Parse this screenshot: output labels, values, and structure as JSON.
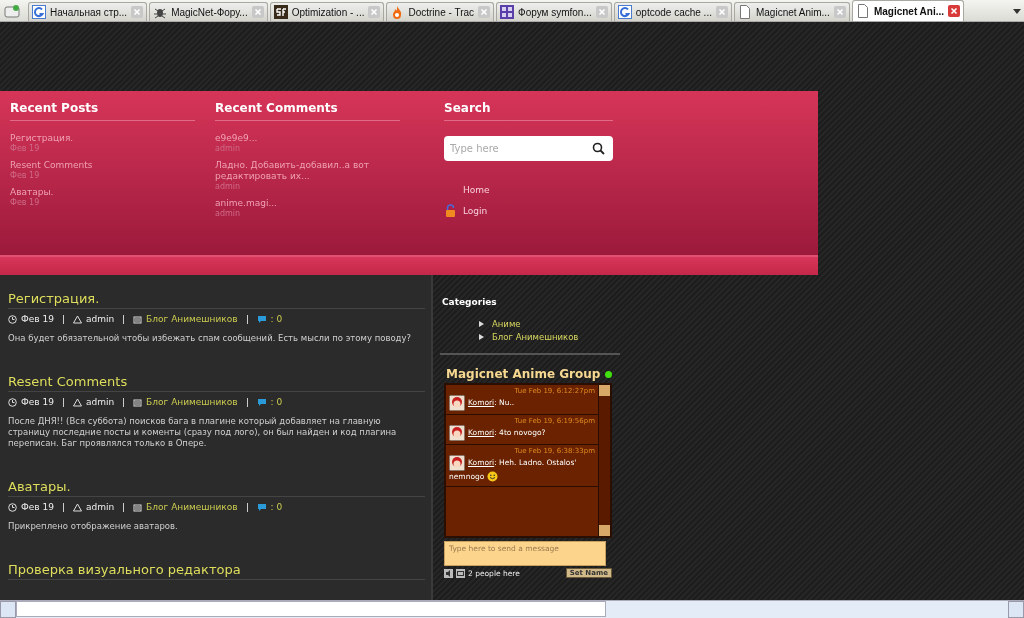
{
  "browser_tabs": [
    {
      "label": "Начальная стр...",
      "selected": false
    },
    {
      "label": "MagicNet-Фору...",
      "selected": false
    },
    {
      "label": "Optimization - ...",
      "selected": false
    },
    {
      "label": "Doctrine - Trac",
      "selected": false
    },
    {
      "label": "Форум symfon...",
      "selected": false
    },
    {
      "label": "optcode cache ...",
      "selected": false
    },
    {
      "label": "Magicnet Anim...",
      "selected": false
    },
    {
      "label": "Magicnet Ani...",
      "selected": true
    }
  ],
  "header": {
    "recent_posts": {
      "title": "Recent Posts",
      "items": [
        {
          "title": "Регистрация.",
          "date": "Фев 19"
        },
        {
          "title": "Resent Comments",
          "date": "Фев 19"
        },
        {
          "title": "Аватары.",
          "date": "Фев 19"
        }
      ]
    },
    "recent_comments": {
      "title": "Recent Comments",
      "items": [
        {
          "text": "e9e9e9...",
          "author": "admin"
        },
        {
          "text": "Ладно. Добавить-добавил..а вот редактировать их...",
          "author": "admin"
        },
        {
          "text": "anime.magi...",
          "author": "admin"
        }
      ]
    },
    "search": {
      "title": "Search",
      "placeholder": "Type here"
    },
    "links": [
      {
        "label": "Home"
      },
      {
        "label": "Login"
      }
    ]
  },
  "posts": [
    {
      "title": "Регистрация.",
      "date": "Фев 19",
      "author": "admin",
      "category": "Блог Анимешников",
      "comments": ": 0",
      "body": "Она будет обязательной чтобы избежать спам сообщений. Есть мысли по этому поводу?"
    },
    {
      "title": "Resent Comments",
      "date": "Фев 19",
      "author": "admin",
      "category": "Блог Анимешников",
      "comments": ": 0",
      "body": "После ДНЯ!! (Вся суббота) поисков бага в плагине который добавляет  на главную страницу последние посты и коменты (сразу под лого), он был найден и код плагина переписан. Баг проявлялся только в Опере."
    },
    {
      "title": "Аватары.",
      "date": "Фев 19",
      "author": "admin",
      "category": "Блог Анимешников",
      "comments": ": 0",
      "body": "Прикреплено отображение аватаров."
    },
    {
      "title": "Проверка визуального редактора"
    }
  ],
  "categories": {
    "title": "Categories",
    "items": [
      "Аниме",
      "Блог Анимешников"
    ]
  },
  "chat": {
    "title": "Magicnet Anime Group",
    "online": true,
    "messages": [
      {
        "time": "Tue Feb 19, 6:12:27pm",
        "user": "Komori",
        "text": ":  Nu..",
        "smiley": false
      },
      {
        "time": "Tue Feb 19, 6:19:56pm",
        "user": "Komori",
        "text": ":  4to novogo?",
        "smiley": false
      },
      {
        "time": "Tue Feb 19, 6:38:33pm",
        "user": "Komori",
        "text": ":  Heh. Ladno. Ostalos' nemnogo",
        "smiley": true
      }
    ],
    "placeholder": "Type here to send a message",
    "people": "2 people here",
    "set_name": "Set Name"
  }
}
